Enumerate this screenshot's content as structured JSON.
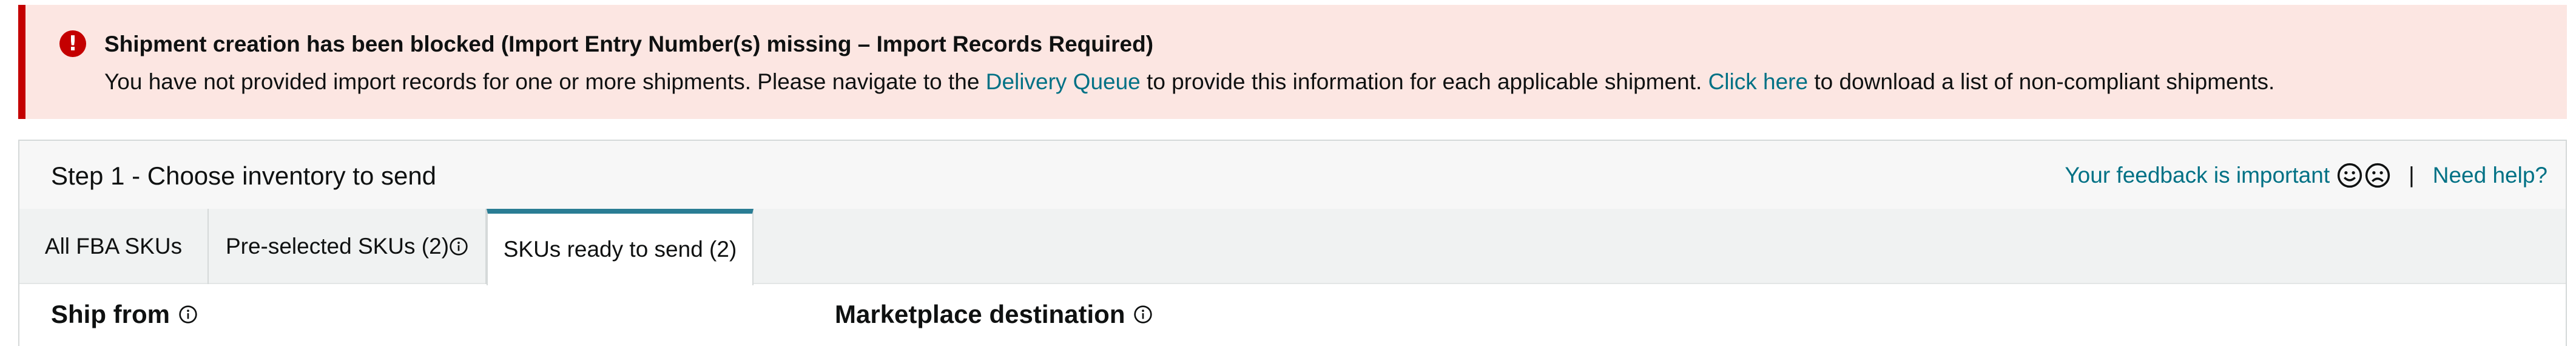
{
  "alert": {
    "icon": "error-exclamation-icon",
    "title": "Shipment creation has been blocked (Import Entry Number(s) missing – Import Records Required)",
    "body_prefix": "You have not provided import records for one or more shipments. Please navigate to the",
    "delivery_queue_link": "Delivery Queue",
    "body_middle": "to provide this information for each applicable shipment.",
    "click_here_link": "Click here",
    "body_suffix": "to download a list of non-compliant shipments.",
    "colors": {
      "background": "#fce6e2",
      "accent": "#c40000"
    }
  },
  "step": {
    "title": "Step 1 - Choose inventory to send",
    "feedback_link": "Your feedback is important",
    "feedback_icons": [
      "smile-face-icon",
      "frown-face-icon"
    ],
    "separator": "|",
    "help_link": "Need help?"
  },
  "tabs": [
    {
      "label": "All FBA SKUs",
      "active": false
    },
    {
      "label": "Pre-selected SKUs (2)",
      "active": false,
      "icon": "info-icon"
    },
    {
      "label": "SKUs ready to send (2)",
      "active": true
    }
  ],
  "sections": {
    "ship_from": "Ship from",
    "marketplace_destination": "Marketplace destination"
  },
  "colors": {
    "link": "#007185",
    "active_tab_top": "#2a7d94"
  }
}
